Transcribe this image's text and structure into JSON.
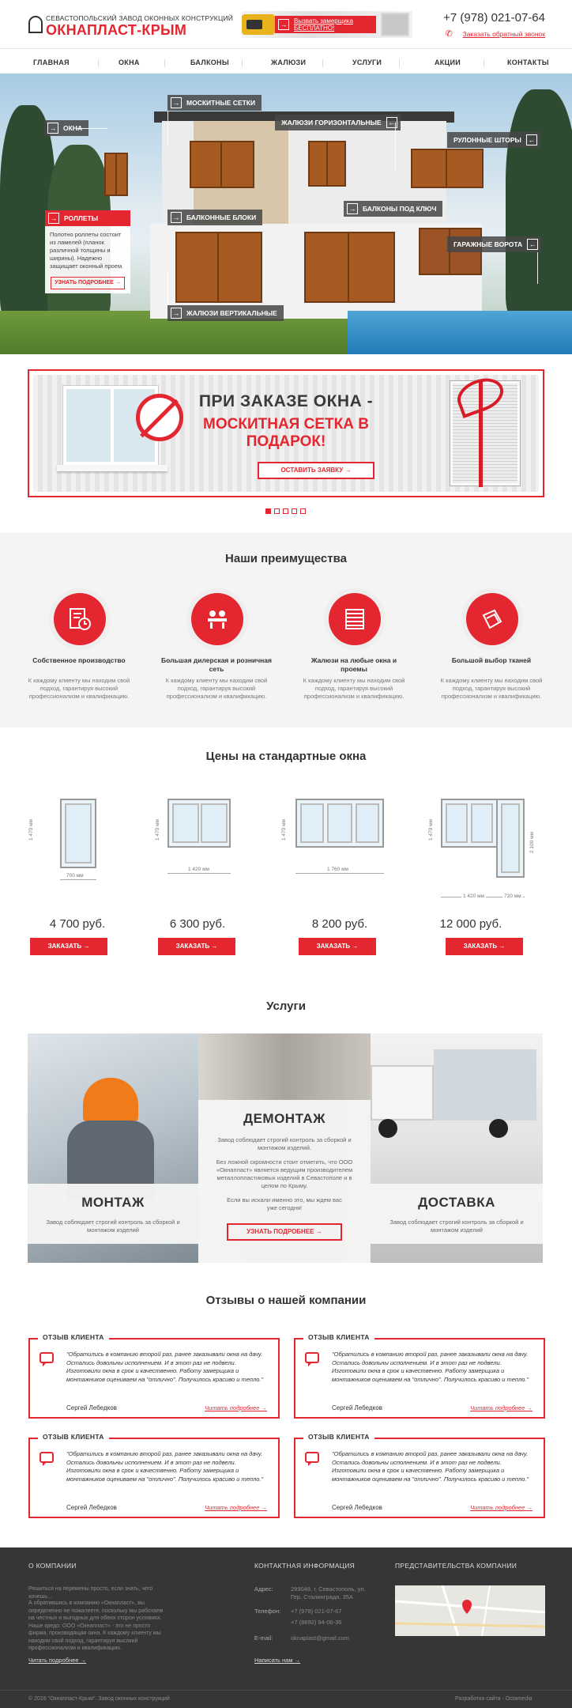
{
  "header": {
    "logo_top": "СЕВАСТОПОЛЬСКИЙ ЗАВОД ОКОННЫХ КОНСТРУКЦИЙ",
    "logo_main": "ОКНАПЛАСТ-КРЫМ",
    "promo_text": "Вызвать замерщика БЕСПЛАТНО!",
    "phone": "+7 (978) 021-07-64",
    "callback": "Заказать обратный звонок"
  },
  "nav": [
    "ГЛАВНАЯ",
    "ОКНА",
    "БАЛКОНЫ",
    "ЖАЛЮЗИ",
    "УСЛУГИ",
    "АКЦИИ",
    "КОНТАКТЫ"
  ],
  "hero": {
    "tags": {
      "mosquito": "МОСКИТНЫЕ СЕТКИ",
      "windows": "ОКНА",
      "blinds_h": "ЖАЛЮЗИ ГОРИЗОНТАЛЬНЫЕ",
      "roller_blinds": "РУЛОННЫЕ ШТОРЫ",
      "balcony_key": "БАЛКОНЫ ПОД КЛЮЧ",
      "balcony_blocks": "БАЛКОННЫЕ БЛОКИ",
      "garage": "ГАРАЖНЫЕ ВОРОТА",
      "blinds_v": "ЖАЛЮЗИ ВЕРТИКАЛЬНЫЕ"
    },
    "rollers": {
      "title": "РОЛЛЕТЫ",
      "text": "Полотно роллеты состоит из ламелей (планок различной толщины и ширины). Надежно защищает оконный проем.",
      "button": "УЗНАТЬ ПОДРОБНЕЕ"
    }
  },
  "banner": {
    "line1": "ПРИ ЗАКАЗЕ ОКНА -",
    "line2": "МОСКИТНАЯ СЕТКА В ПОДАРОК!",
    "button": "ОСТАВИТЬ ЗАЯВКУ"
  },
  "advantages": {
    "title": "Наши преимущества",
    "items": [
      {
        "name": "Собственное производство",
        "desc": "К каждому клиенту мы находим свой подход, гарантируя высокий профессионализм и квалификацию."
      },
      {
        "name": "Большая дилерская и розничная сеть",
        "desc": "К каждому клиенту мы находим свой подход, гарантируя высокий профессионализм и квалификацию."
      },
      {
        "name": "Жалюзи на любые окна и проемы",
        "desc": "К каждому клиенту мы находим свой подход, гарантируя высокий профессионализм и квалификацию."
      },
      {
        "name": "Большой выбор тканей",
        "desc": "К каждому клиенту мы находим свой подход, гарантируя высокий профессионализм и квалификацию."
      }
    ]
  },
  "prices": {
    "title": "Цены на стандартные окна",
    "items": [
      {
        "height": "1 470 мм",
        "width": "700 мм",
        "price": "4 700 руб.",
        "button": "ЗАКАЗАТЬ"
      },
      {
        "height": "1 470 мм",
        "width": "1 420 мм",
        "price": "6 300 руб.",
        "button": "ЗАКАЗАТЬ"
      },
      {
        "height": "1 470 мм",
        "width": "1 760 мм",
        "price": "8 200 руб.",
        "button": "ЗАКАЗАТЬ"
      },
      {
        "height": "1 470 мм",
        "height2": "2 100 мм",
        "width": "1 420 мм",
        "width2": "720 мм",
        "price": "12 000 руб.",
        "button": "ЗАКАЗАТЬ"
      }
    ]
  },
  "services": {
    "title": "Услуги",
    "items": [
      {
        "name": "МОНТАЖ",
        "text": "Завод соблюдает строгий контроль за сборкой и монтажом изделий"
      },
      {
        "name": "ДЕМОНТАЖ",
        "text": "Завод соблюдает строгий контроль за сборкой и монтажом изделий.",
        "text2": "Без ложной скромности стоит отметить, что ООО «Окнапласт» является ведущим производителем металлопластиковых изделий в Севастополе и в целом по Крыму.",
        "text3": "Если вы искали именно это, мы ждем вас уже сегодня!",
        "button": "УЗНАТЬ ПОДРОБНЕЕ"
      },
      {
        "name": "ДОСТАВКА",
        "text": "Завод соблюдает строгий контроль за сборкой и монтажом изделий"
      }
    ]
  },
  "reviews": {
    "title": "Отзывы о нашей компании",
    "items": [
      {
        "head": "ОТЗЫВ КЛИЕНТА",
        "text": "\"Обратились в компанию второй раз, ранее заказывали окна на дачу. Остались довольны исполнением. И в этот раз не подвели. Изготовили окна в срок и качественно. Работу замерщика и монтажников оцениваем на \"отлично\". Получилось красиво и тепло.\"",
        "author": "Сергей Лебедков",
        "link": "Читать подробнее"
      },
      {
        "head": "ОТЗЫВ КЛИЕНТА",
        "text": "\"Обратились в компанию второй раз, ранее заказывали окна на дачу. Остались довольны исполнением. И в этот раз не подвели. Изготовили окна в срок и качественно. Работу замерщика и монтажников оцениваем на \"отлично\". Получилось красиво и тепло.\"",
        "author": "Сергей Лебедков",
        "link": "Читать подробнее"
      },
      {
        "head": "ОТЗЫВ КЛИЕНТА",
        "text": "\"Обратились в компанию второй раз, ранее заказывали окна на дачу. Остались довольны исполнением. И в этот раз не подвели. Изготовили окна в срок и качественно. Работу замерщика и монтажников оцениваем на \"отлично\". Получилось красиво и тепло.\"",
        "author": "Сергей Лебедков",
        "link": "Читать подробнее"
      },
      {
        "head": "ОТЗЫВ КЛИЕНТА",
        "text": "\"Обратились в компанию второй раз, ранее заказывали окна на дачу. Остались довольны исполнением. И в этот раз не подвели. Изготовили окна в срок и качественно. Работу замерщика и монтажников оцениваем на \"отлично\". Получилось красиво и тепло.\"",
        "author": "Сергей Лебедков",
        "link": "Читать подробнее"
      }
    ]
  },
  "footer": {
    "about_title": "О КОМПАНИИ",
    "about_p1": "Решиться на перемены просто, если знать, чего хочешь...",
    "about_p2": "А обратившись в компанию «Окнапласт», вы определенно не пожалеете, поскольку мы работаем на честных и выгодных для обеих сторон условиях. Наше кредо: ООО «Окнапласт» - это не просто фирма, производящая окна. К каждому клиенту мы находим свой подход, гарантируя высокий профессионализм и квалификацию.",
    "about_link": "Читать подробнее",
    "contacts_title": "КОНТАКТНАЯ ИНФОРМАЦИЯ",
    "address_label": "Адрес:",
    "address": "299048, г. Севастополь, ул. Гер. Сталинграда, 35А",
    "phone_label": "Телефон:",
    "phone1": "+7 (978) 021-07-67",
    "phone2": "+7 (8692) 94-06-36",
    "email_label": "E-mail:",
    "email": "oknaplast@gmail.com",
    "contacts_link": "Написать нам",
    "rep_title": "ПРЕДСТАВИТЕЛЬСТВА КОМПАНИИ",
    "copyright": "© 2016 \"Окнапласт-Крым\". Завод оконных конструкций",
    "dev": "Разработка сайта - Octamedia"
  }
}
